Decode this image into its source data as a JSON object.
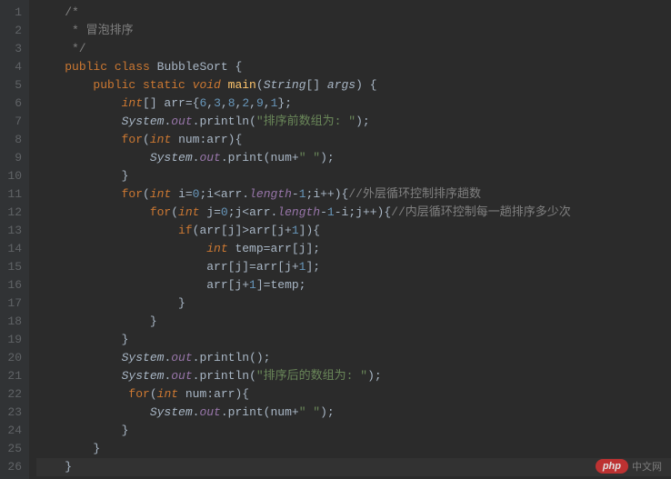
{
  "lines": [
    {
      "n": 1,
      "tokens": [
        {
          "t": "    ",
          "c": ""
        },
        {
          "t": "/*",
          "c": "comment"
        }
      ]
    },
    {
      "n": 2,
      "tokens": [
        {
          "t": "     * 冒泡排序",
          "c": "comment"
        }
      ]
    },
    {
      "n": 3,
      "tokens": [
        {
          "t": "     */",
          "c": "comment"
        }
      ]
    },
    {
      "n": 4,
      "tokens": [
        {
          "t": "    ",
          "c": ""
        },
        {
          "t": "public class ",
          "c": "keyword"
        },
        {
          "t": "BubbleSort {",
          "c": "class-name"
        }
      ]
    },
    {
      "n": 5,
      "tokens": [
        {
          "t": "        ",
          "c": ""
        },
        {
          "t": "public static ",
          "c": "keyword"
        },
        {
          "t": "void ",
          "c": "keyword-italic"
        },
        {
          "t": "main",
          "c": "method-name"
        },
        {
          "t": "(",
          "c": "punc"
        },
        {
          "t": "String",
          "c": "type"
        },
        {
          "t": "[] ",
          "c": "punc"
        },
        {
          "t": "args",
          "c": "param"
        },
        {
          "t": ") {",
          "c": "punc"
        }
      ]
    },
    {
      "n": 6,
      "tokens": [
        {
          "t": "            ",
          "c": ""
        },
        {
          "t": "int",
          "c": "keyword-italic"
        },
        {
          "t": "[] arr={",
          "c": "punc"
        },
        {
          "t": "6",
          "c": "num"
        },
        {
          "t": ",",
          "c": "punc"
        },
        {
          "t": "3",
          "c": "num"
        },
        {
          "t": ",",
          "c": "punc"
        },
        {
          "t": "8",
          "c": "num"
        },
        {
          "t": ",",
          "c": "punc"
        },
        {
          "t": "2",
          "c": "num"
        },
        {
          "t": ",",
          "c": "punc"
        },
        {
          "t": "9",
          "c": "num"
        },
        {
          "t": ",",
          "c": "punc"
        },
        {
          "t": "1",
          "c": "num"
        },
        {
          "t": "};",
          "c": "punc"
        }
      ]
    },
    {
      "n": 7,
      "tokens": [
        {
          "t": "            ",
          "c": ""
        },
        {
          "t": "System",
          "c": "type"
        },
        {
          "t": ".",
          "c": "punc"
        },
        {
          "t": "out",
          "c": "static-field"
        },
        {
          "t": ".println(",
          "c": "punc"
        },
        {
          "t": "\"排序前数组为: \"",
          "c": "string"
        },
        {
          "t": ");",
          "c": "punc"
        }
      ]
    },
    {
      "n": 8,
      "tokens": [
        {
          "t": "            ",
          "c": ""
        },
        {
          "t": "for",
          "c": "keyword"
        },
        {
          "t": "(",
          "c": "punc"
        },
        {
          "t": "int ",
          "c": "keyword-italic"
        },
        {
          "t": "num:arr){",
          "c": "punc"
        }
      ]
    },
    {
      "n": 9,
      "tokens": [
        {
          "t": "                ",
          "c": ""
        },
        {
          "t": "System",
          "c": "type"
        },
        {
          "t": ".",
          "c": "punc"
        },
        {
          "t": "out",
          "c": "static-field"
        },
        {
          "t": ".print(num+",
          "c": "punc"
        },
        {
          "t": "\" \"",
          "c": "string"
        },
        {
          "t": ");",
          "c": "punc"
        }
      ]
    },
    {
      "n": 10,
      "tokens": [
        {
          "t": "            }",
          "c": "punc"
        }
      ]
    },
    {
      "n": 11,
      "tokens": [
        {
          "t": "            ",
          "c": ""
        },
        {
          "t": "for",
          "c": "keyword"
        },
        {
          "t": "(",
          "c": "punc"
        },
        {
          "t": "int ",
          "c": "keyword-italic"
        },
        {
          "t": "i=",
          "c": "punc"
        },
        {
          "t": "0",
          "c": "num"
        },
        {
          "t": ";i<arr.",
          "c": "punc"
        },
        {
          "t": "length",
          "c": "static-field"
        },
        {
          "t": "-",
          "c": "punc"
        },
        {
          "t": "1",
          "c": "num"
        },
        {
          "t": ";i++){",
          "c": "punc"
        },
        {
          "t": "//外层循环控制排序趟数",
          "c": "line-comment"
        }
      ]
    },
    {
      "n": 12,
      "tokens": [
        {
          "t": "                ",
          "c": ""
        },
        {
          "t": "for",
          "c": "keyword"
        },
        {
          "t": "(",
          "c": "punc"
        },
        {
          "t": "int ",
          "c": "keyword-italic"
        },
        {
          "t": "j=",
          "c": "punc"
        },
        {
          "t": "0",
          "c": "num"
        },
        {
          "t": ";j<arr.",
          "c": "punc"
        },
        {
          "t": "length",
          "c": "static-field"
        },
        {
          "t": "-",
          "c": "punc"
        },
        {
          "t": "1",
          "c": "num"
        },
        {
          "t": "-i;j++){",
          "c": "punc"
        },
        {
          "t": "//内层循环控制每一趟排序多少次",
          "c": "line-comment"
        }
      ]
    },
    {
      "n": 13,
      "tokens": [
        {
          "t": "                    ",
          "c": ""
        },
        {
          "t": "if",
          "c": "keyword"
        },
        {
          "t": "(arr[j]>arr[j+",
          "c": "punc"
        },
        {
          "t": "1",
          "c": "num"
        },
        {
          "t": "]){",
          "c": "punc"
        }
      ]
    },
    {
      "n": 14,
      "tokens": [
        {
          "t": "                        ",
          "c": ""
        },
        {
          "t": "int ",
          "c": "keyword-italic"
        },
        {
          "t": "temp=arr[j];",
          "c": "punc"
        }
      ]
    },
    {
      "n": 15,
      "tokens": [
        {
          "t": "                        arr[j]=arr[j+",
          "c": "punc"
        },
        {
          "t": "1",
          "c": "num"
        },
        {
          "t": "];",
          "c": "punc"
        }
      ]
    },
    {
      "n": 16,
      "tokens": [
        {
          "t": "                        arr[j+",
          "c": "punc"
        },
        {
          "t": "1",
          "c": "num"
        },
        {
          "t": "]=temp;",
          "c": "punc"
        }
      ]
    },
    {
      "n": 17,
      "tokens": [
        {
          "t": "                    }",
          "c": "punc"
        }
      ]
    },
    {
      "n": 18,
      "tokens": [
        {
          "t": "                }",
          "c": "punc"
        }
      ]
    },
    {
      "n": 19,
      "tokens": [
        {
          "t": "            }",
          "c": "punc"
        }
      ]
    },
    {
      "n": 20,
      "tokens": [
        {
          "t": "            ",
          "c": ""
        },
        {
          "t": "System",
          "c": "type"
        },
        {
          "t": ".",
          "c": "punc"
        },
        {
          "t": "out",
          "c": "static-field"
        },
        {
          "t": ".println();",
          "c": "punc"
        }
      ]
    },
    {
      "n": 21,
      "tokens": [
        {
          "t": "            ",
          "c": ""
        },
        {
          "t": "System",
          "c": "type"
        },
        {
          "t": ".",
          "c": "punc"
        },
        {
          "t": "out",
          "c": "static-field"
        },
        {
          "t": ".println(",
          "c": "punc"
        },
        {
          "t": "\"排序后的数组为: \"",
          "c": "string"
        },
        {
          "t": ");",
          "c": "punc"
        }
      ]
    },
    {
      "n": 22,
      "tokens": [
        {
          "t": "             ",
          "c": ""
        },
        {
          "t": "for",
          "c": "keyword"
        },
        {
          "t": "(",
          "c": "punc"
        },
        {
          "t": "int ",
          "c": "keyword-italic"
        },
        {
          "t": "num:arr){",
          "c": "punc"
        }
      ]
    },
    {
      "n": 23,
      "tokens": [
        {
          "t": "                ",
          "c": ""
        },
        {
          "t": "System",
          "c": "type"
        },
        {
          "t": ".",
          "c": "punc"
        },
        {
          "t": "out",
          "c": "static-field"
        },
        {
          "t": ".print(num+",
          "c": "punc"
        },
        {
          "t": "\" \"",
          "c": "string"
        },
        {
          "t": ");",
          "c": "punc"
        }
      ]
    },
    {
      "n": 24,
      "tokens": [
        {
          "t": "            }",
          "c": "punc"
        }
      ]
    },
    {
      "n": 25,
      "tokens": [
        {
          "t": "        }",
          "c": "punc"
        }
      ]
    },
    {
      "n": 26,
      "tokens": [
        {
          "t": "    }",
          "c": "punc"
        }
      ],
      "highlight": true
    }
  ],
  "watermark": {
    "badge": "php",
    "text": "中文网"
  }
}
